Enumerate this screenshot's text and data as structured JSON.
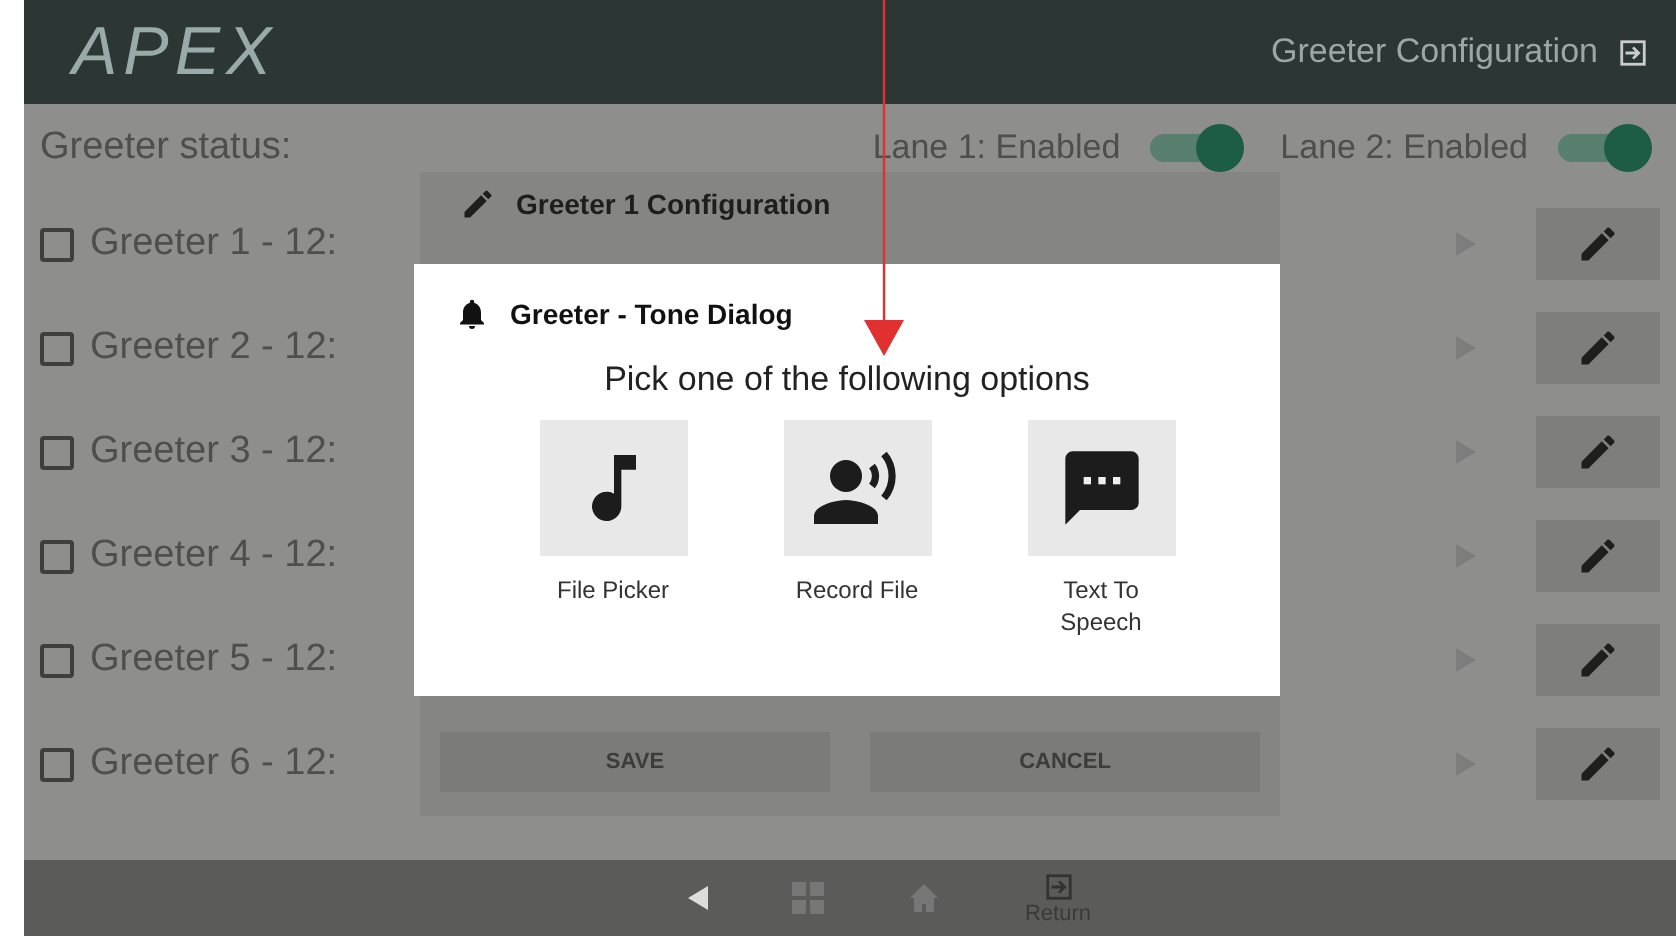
{
  "header": {
    "logo": "APEX",
    "title": "Greeter Configuration"
  },
  "status": {
    "label": "Greeter status:",
    "lanes": [
      {
        "label": "Lane 1: Enabled",
        "on": true
      },
      {
        "label": "Lane 2: Enabled",
        "on": true
      }
    ]
  },
  "greeters": [
    {
      "label": "Greeter 1 - 12:",
      "checked": false
    },
    {
      "label": "Greeter 2 - 12:",
      "checked": false
    },
    {
      "label": "Greeter 3 - 12:",
      "checked": false
    },
    {
      "label": "Greeter 4 - 12:",
      "checked": false
    },
    {
      "label": "Greeter 5 - 12:",
      "checked": false
    },
    {
      "label": "Greeter 6 - 12:",
      "checked": false
    }
  ],
  "config_dialog": {
    "title": "Greeter 1 Configuration",
    "buttons": [
      "SAVE",
      "CANCEL"
    ]
  },
  "tone_dialog": {
    "title": "Greeter - Tone Dialog",
    "prompt": "Pick one of the following options",
    "options": [
      {
        "kind": "music",
        "label": "File Picker"
      },
      {
        "kind": "voice",
        "label": "Record File"
      },
      {
        "kind": "chat",
        "label": "Text To Speech"
      }
    ]
  },
  "nav": {
    "return_label": "Return"
  }
}
